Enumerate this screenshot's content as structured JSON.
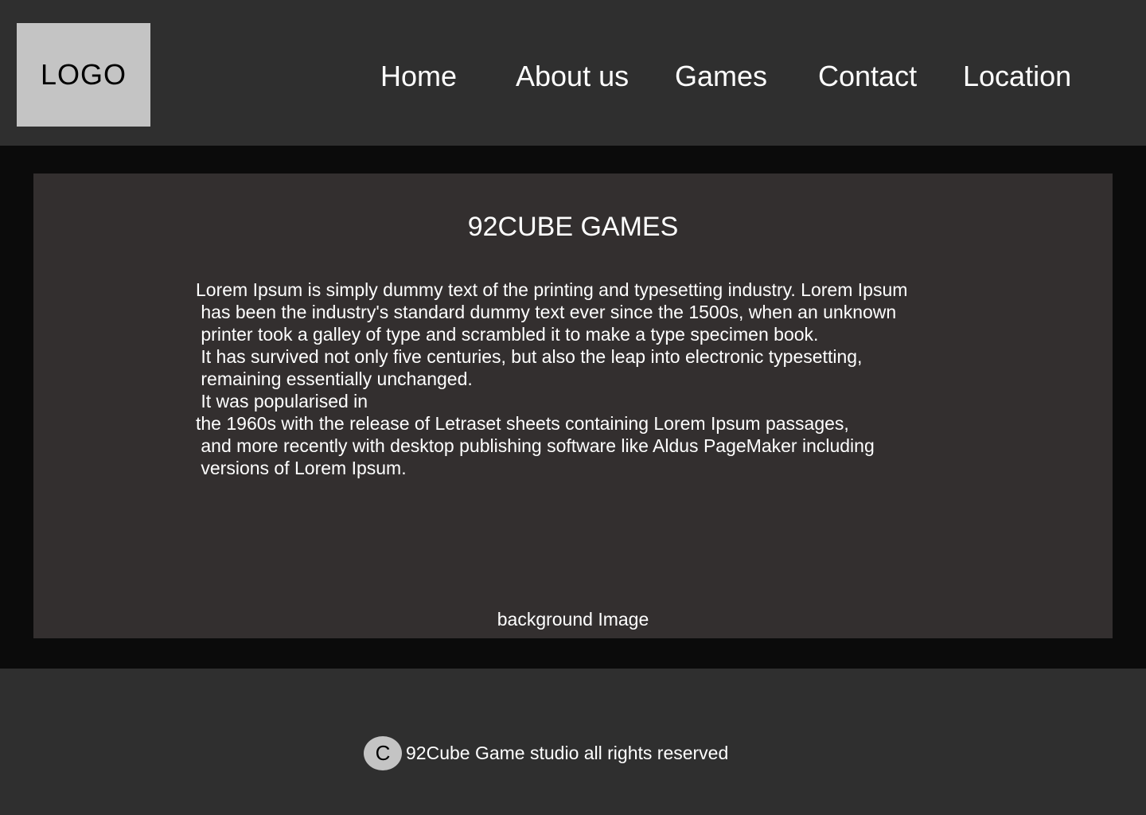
{
  "header": {
    "logo": "LOGO",
    "nav": {
      "home": "Home",
      "about": "About us",
      "games": "Games",
      "contact": "Contact",
      "location": "Location"
    }
  },
  "main": {
    "title": "92CUBE GAMES",
    "paragraph_lines": [
      "Lorem Ipsum is simply dummy text of the printing and typesetting industry. Lorem Ipsum",
      " has been the industry's standard dummy text ever since the 1500s, when an unknown",
      " printer took a galley of type and scrambled it to make a type specimen book.",
      " It has survived not only five centuries, but also the leap into electronic typesetting,",
      " remaining essentially unchanged.",
      " It was popularised in",
      "the 1960s with the release of Letraset sheets containing Lorem Ipsum passages,",
      " and more recently with desktop publishing software like Aldus PageMaker including",
      " versions of Lorem Ipsum."
    ],
    "background_label": "background Image"
  },
  "footer": {
    "copyright_symbol": "C",
    "text": "92Cube Game studio all rights reserved"
  },
  "colors": {
    "header_bg": "#2f2f2f",
    "page_bg": "#0b0b0b",
    "panel_bg": "#332f2f",
    "logo_bg": "#c4c4c4",
    "text": "#ffffff"
  }
}
